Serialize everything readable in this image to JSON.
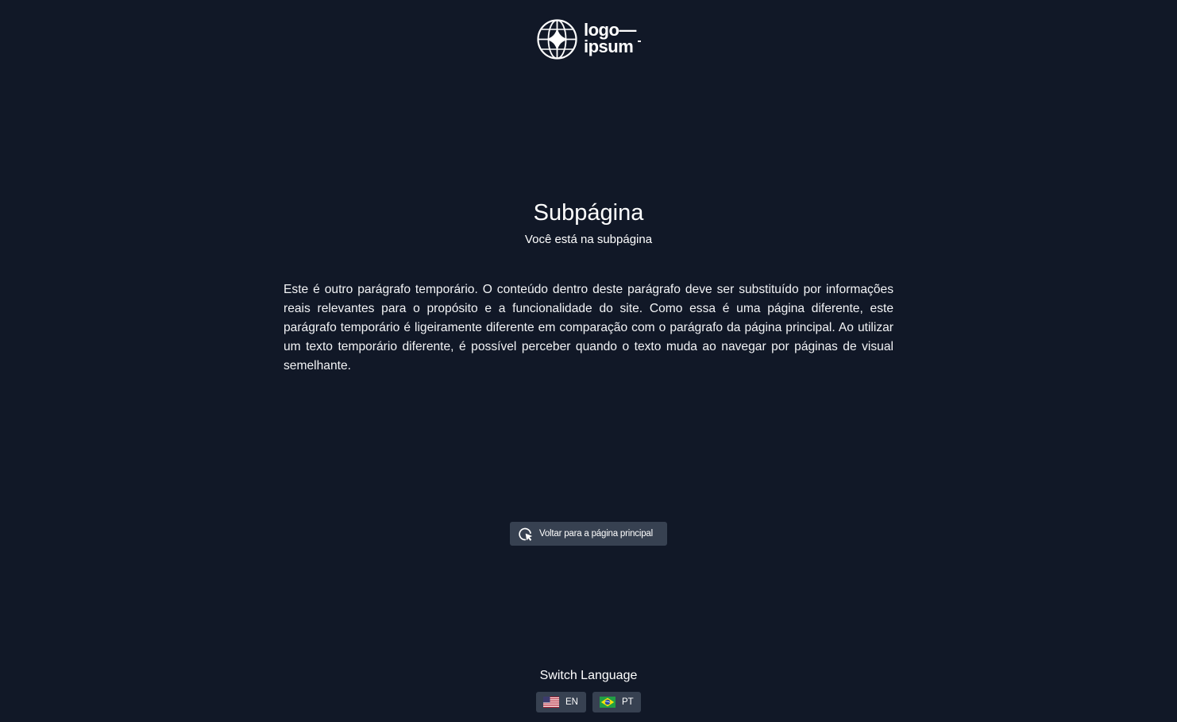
{
  "logo": {
    "line1": "logo—",
    "line2": "ipsum",
    "icon": "globe-star-icon"
  },
  "main": {
    "title": "Subpágina",
    "subtitle": "Você está na subpágina",
    "paragraph": "Este é outro parágrafo temporário. O conteúdo dentro deste parágrafo deve ser substituído por informações reais relevantes para o propósito e a funcionalidade do site. Como essa é uma página diferente, este parágrafo temporário é ligeiramente diferente em comparação com o parágrafo da página principal. Ao utilizar um texto temporário diferente, é possível perceber quando o texto muda ao navegar por páginas de visual semelhante."
  },
  "back_button": {
    "label": "Voltar para a página principal",
    "icon": "return-cursor-icon"
  },
  "language": {
    "heading": "Switch Language",
    "options": [
      {
        "code": "EN",
        "icon": "us-flag-icon"
      },
      {
        "code": "PT",
        "icon": "brazil-flag-icon"
      }
    ]
  },
  "colors": {
    "background": "#111827",
    "button_bg": "#374151",
    "text": "#ffffff"
  }
}
